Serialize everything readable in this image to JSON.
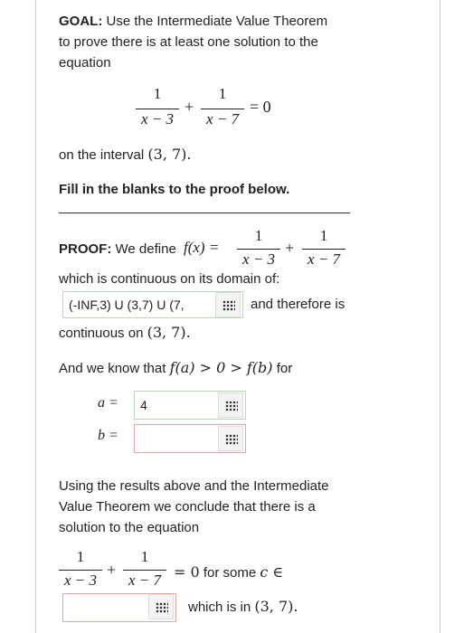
{
  "goal": {
    "label": "GOAL:",
    "text1": "Use the Intermediate Value Theorem",
    "text2": "to prove there is at least one solution to the",
    "text3": "equation"
  },
  "equation": {
    "num1": "1",
    "den1": "x − 3",
    "plus": "+",
    "num2": "1",
    "den2": "x − 7",
    "eq": "= 0"
  },
  "interval_line": {
    "prefix": "on the interval",
    "interval": "(3, 7)."
  },
  "instruction": "Fill in the blanks to the proof below.",
  "proof": {
    "label": "PROOF:",
    "define_text": "We define",
    "fx": "f(x) =",
    "num1": "1",
    "den1": "x − 3",
    "plus": "+",
    "num2": "1",
    "den2": "x − 7",
    "continuous_text": "which is continuous on its domain of:",
    "domain_value": "(-INF,3) U (3,7) U (7,",
    "therefore_text": "and therefore is",
    "continuous_on": "continuous on",
    "continuous_interval": "(3, 7)."
  },
  "know": {
    "text": "And we know that",
    "math": "f(a) > 0 > f(b)",
    "suffix": "for"
  },
  "a_field": {
    "label": "a =",
    "value": "4"
  },
  "b_field": {
    "label": "b =",
    "value": ""
  },
  "conclusion": {
    "line1": "Using the results above and the Intermediate",
    "line2": "Value Theorem we conclude that there is a",
    "line3": "solution to the equation"
  },
  "final_equation": {
    "num1": "1",
    "den1": "x − 3",
    "plus": "+",
    "num2": "1",
    "den2": "x − 7",
    "eq": "= 0",
    "some_text": "for some",
    "c_in": "c ∈",
    "which_text": "which is in",
    "interval": "(3, 7)."
  },
  "final_field": {
    "value": ""
  }
}
